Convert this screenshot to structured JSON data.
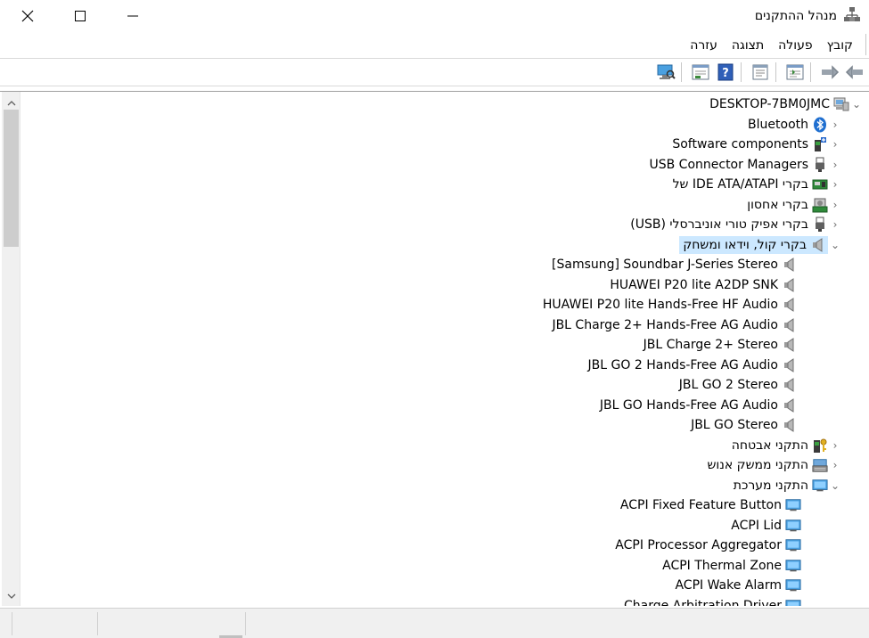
{
  "window": {
    "title": "מנהל ההתקנים"
  },
  "menu": [
    {
      "label": "קובץ"
    },
    {
      "label": "פעולה"
    },
    {
      "label": "תצוגה"
    },
    {
      "label": "עזרה"
    }
  ],
  "toolbar": {
    "buttons": [
      "back-icon",
      "forward-icon",
      "show-hide-icon",
      "properties-icon",
      "help-icon",
      "update-driver-icon",
      "scan-hardware-icon"
    ]
  },
  "tree": {
    "root": {
      "label": "DESKTOP-7BM0JMC",
      "expanded": true,
      "icon": "computer-icon"
    },
    "categories": [
      {
        "label": "Bluetooth",
        "icon": "bluetooth-icon",
        "expanded": false
      },
      {
        "label": "Software components",
        "icon": "software-component-icon",
        "expanded": false
      },
      {
        "label": "USB Connector Managers",
        "icon": "usb-icon",
        "expanded": false
      },
      {
        "label": "בקרי IDE ATA/ATAPI של",
        "icon": "ide-controller-icon",
        "expanded": false
      },
      {
        "label": "בקרי אחסון",
        "icon": "storage-controller-icon",
        "expanded": false
      },
      {
        "label": "בקרי אפיק טורי אוניברסלי (USB)",
        "icon": "usb-icon",
        "expanded": false
      },
      {
        "label": "בקרי קול, וידאו ומשחק",
        "icon": "speaker-icon",
        "expanded": true,
        "selected": true,
        "children": [
          "[Samsung] Soundbar J-Series Stereo",
          "HUAWEI P20 lite A2DP SNK",
          "HUAWEI P20 lite Hands-Free HF Audio",
          "JBL Charge 2+ Hands-Free AG Audio",
          "JBL Charge 2+ Stereo",
          "JBL GO 2 Hands-Free AG Audio",
          "JBL GO 2 Stereo",
          "JBL GO Hands-Free AG Audio",
          "JBL GO Stereo"
        ]
      },
      {
        "label": "התקני אבטחה",
        "icon": "security-device-icon",
        "expanded": false
      },
      {
        "label": "התקני ממשק אנוש",
        "icon": "hid-icon",
        "expanded": false
      },
      {
        "label": "התקני מערכת",
        "icon": "system-device-icon",
        "expanded": true,
        "children": [
          "ACPI Fixed Feature Button",
          "ACPI Lid",
          "ACPI Processor Aggregator",
          "ACPI Thermal Zone",
          "ACPI Wake Alarm",
          "Charge Arbitration Driver"
        ]
      }
    ]
  },
  "colors": {
    "selection": "#cce8ff",
    "scrollbar": "#f0f0f0",
    "thumb": "#cdcdcd"
  }
}
